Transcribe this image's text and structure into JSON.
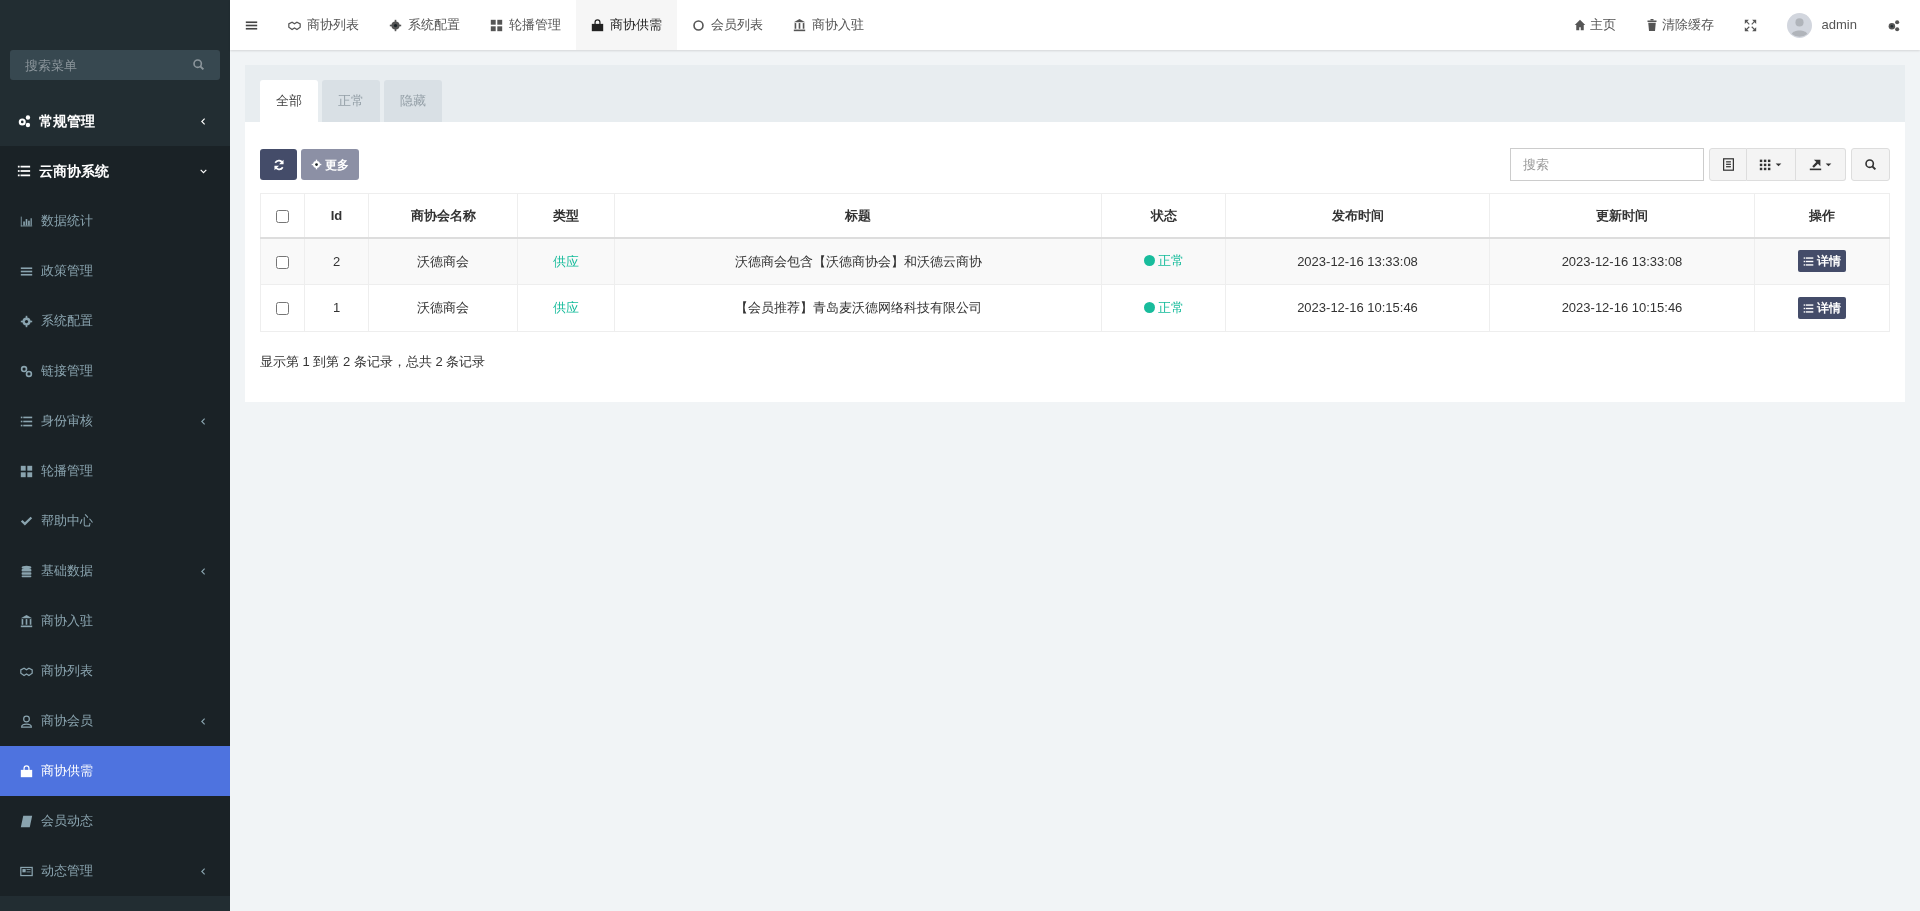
{
  "sidebar": {
    "search": {
      "placeholder": "搜索菜单"
    },
    "items": [
      {
        "label": "常规管理",
        "expanded": false,
        "selected": false
      },
      {
        "label": "云商协系统",
        "expanded": true,
        "selected": false,
        "children": [
          {
            "label": "数据统计",
            "selected": false
          },
          {
            "label": "政策管理",
            "selected": false
          },
          {
            "label": "系统配置",
            "selected": false
          },
          {
            "label": "链接管理",
            "selected": false
          },
          {
            "label": "身份审核",
            "selected": false,
            "expanded": false
          },
          {
            "label": "轮播管理",
            "selected": false
          },
          {
            "label": "帮助中心",
            "selected": false
          },
          {
            "label": "基础数据",
            "selected": false,
            "expanded": false
          },
          {
            "label": "商协入驻",
            "selected": false
          },
          {
            "label": "商协列表",
            "selected": false
          },
          {
            "label": "商协会员",
            "selected": false,
            "expanded": false
          },
          {
            "label": "商协供需",
            "selected": true
          },
          {
            "label": "会员动态",
            "selected": false
          },
          {
            "label": "动态管理",
            "selected": false,
            "expanded": false
          }
        ]
      }
    ]
  },
  "topbar": {
    "tabs": [
      {
        "label": "商协列表",
        "selected": false
      },
      {
        "label": "系统配置",
        "selected": false
      },
      {
        "label": "轮播管理",
        "selected": false
      },
      {
        "label": "商协供需",
        "selected": true
      },
      {
        "label": "会员列表",
        "selected": false
      },
      {
        "label": "商协入驻",
        "selected": false
      }
    ],
    "links": [
      "主页",
      "清除缓存"
    ],
    "user": "admin"
  },
  "filter_tabs": [
    {
      "label": "全部",
      "selected": true
    },
    {
      "label": "正常",
      "selected": false
    },
    {
      "label": "隐藏",
      "selected": false
    }
  ],
  "toolbar": {
    "more_button": {
      "label": "更多",
      "disabled": true
    },
    "search": {
      "placeholder": "搜索"
    }
  },
  "table": {
    "select_all": false,
    "columns": [
      "Id",
      "商协会名称",
      "类型",
      "标题",
      "状态",
      "发布时间",
      "更新时间",
      "操作"
    ],
    "rows": [
      {
        "checked": false,
        "id": "2",
        "name": "沃德商会",
        "type": "供应",
        "title": "沃德商会包含【沃德商协会】和沃德云商协",
        "status": "正常",
        "color": "#18bc9c",
        "published": "2023-12-16 13:33:08",
        "updated": "2023-12-16 13:33:08",
        "action": "详情"
      },
      {
        "checked": false,
        "id": "1",
        "name": "沃德商会",
        "type": "供应",
        "title": "【会员推荐】青岛麦沃德网络科技有限公司",
        "status": "正常",
        "color": "#18bc9c",
        "published": "2023-12-16 10:15:46",
        "updated": "2023-12-16 10:15:46",
        "action": "详情"
      }
    ]
  },
  "pagination_info": "显示第 1 到第 2 条记录，总共 2 条记录"
}
